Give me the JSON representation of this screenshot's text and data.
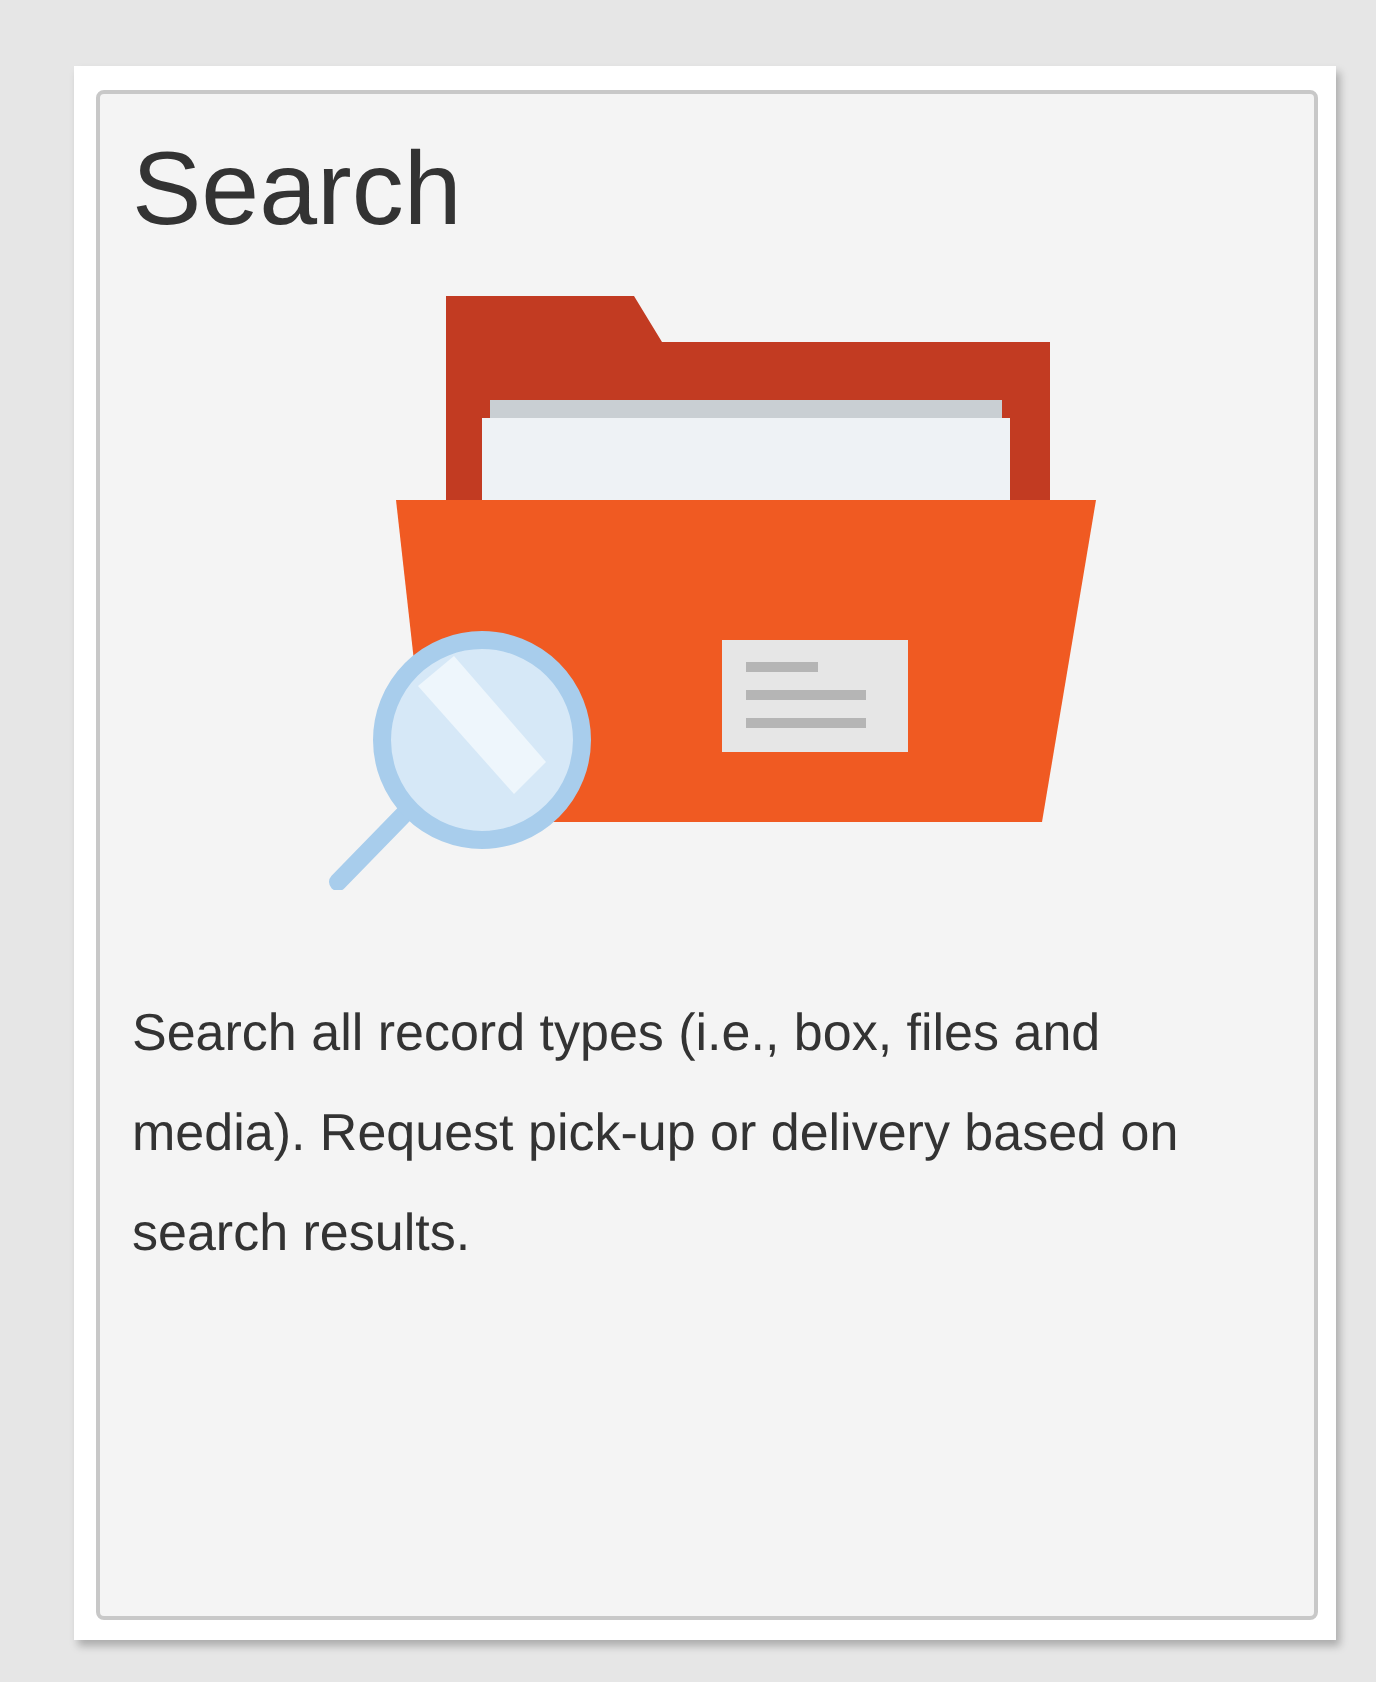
{
  "card": {
    "title": "Search",
    "description": "Search all record types (i.e., box, files and media). Request pick-up or delivery based on search results."
  }
}
